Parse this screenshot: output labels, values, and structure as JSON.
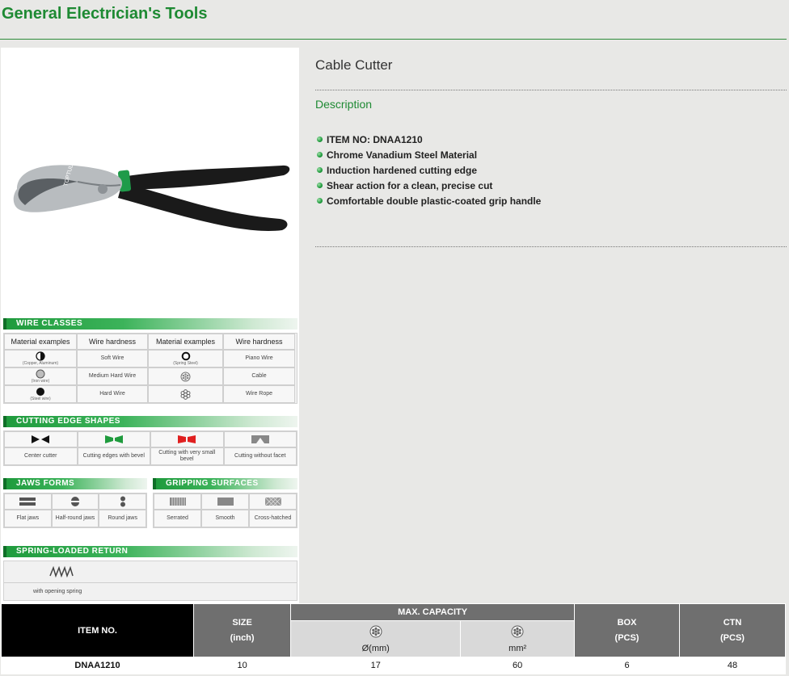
{
  "page": {
    "title": "General Electrician's Tools"
  },
  "product": {
    "name": "Cable Cutter",
    "description_label": "Description",
    "features": [
      "ITEM NO: DNAA1210",
      "Chrome Vanadium Steel Material",
      "Induction hardened cutting edge",
      "Shear action for a clean, precise cut",
      "Comfortable double plastic-coated grip handle"
    ],
    "brand_mark": "TOPTUL"
  },
  "colors": {
    "accent": "#1e8a33",
    "header_black": "#000000",
    "header_grey": "#6f6f6f"
  },
  "wire_classes": {
    "title": "WIRE CLASSES",
    "headers": [
      "Material examples",
      "Wire hardness",
      "Material examples",
      "Wire hardness"
    ],
    "rows": [
      {
        "left_note": "(Copper, Aluminum)",
        "left_hardness": "Soft Wire",
        "right_note": "(Spring Steel)",
        "right_hardness": "Piano Wire"
      },
      {
        "left_note": "(Iron wire)",
        "left_hardness": "Medium Hard Wire",
        "right_note": "",
        "right_hardness": "Cable"
      },
      {
        "left_note": "(Steel wire)",
        "left_hardness": "Hard Wire",
        "right_note": "",
        "right_hardness": "Wire Rope"
      }
    ]
  },
  "cutting_edges": {
    "title": "CUTTING EDGE SHAPES",
    "items": [
      "Center cutter",
      "Cutting edges with bevel",
      "Cutting with very small bevel",
      "Cutting without facet"
    ]
  },
  "jaws_forms": {
    "title": "JAWS FORMS",
    "items": [
      "Flat jaws",
      "Half-round jaws",
      "Round jaws"
    ]
  },
  "gripping_surfaces": {
    "title": "GRIPPING SURFACES",
    "items": [
      "Serrated",
      "Smooth",
      "Cross-hatched"
    ]
  },
  "spring_return": {
    "title": "SPRING-LOADED RETURN",
    "caption": "with opening spring"
  },
  "spec_table": {
    "item_no_header": "ITEM NO.",
    "size_header": "SIZE",
    "size_unit": "(inch)",
    "capacity_header": "MAX. CAPACITY",
    "cap_mm_label": "Ø(mm)",
    "cap_mm2_label": "mm²",
    "box_header": "BOX",
    "box_unit": "(PCS)",
    "ctn_header": "CTN",
    "ctn_unit": "(PCS)",
    "row": {
      "item": "DNAA1210",
      "size": "10",
      "cap_mm": "17",
      "cap_mm2": "60",
      "box": "6",
      "ctn": "48"
    }
  }
}
